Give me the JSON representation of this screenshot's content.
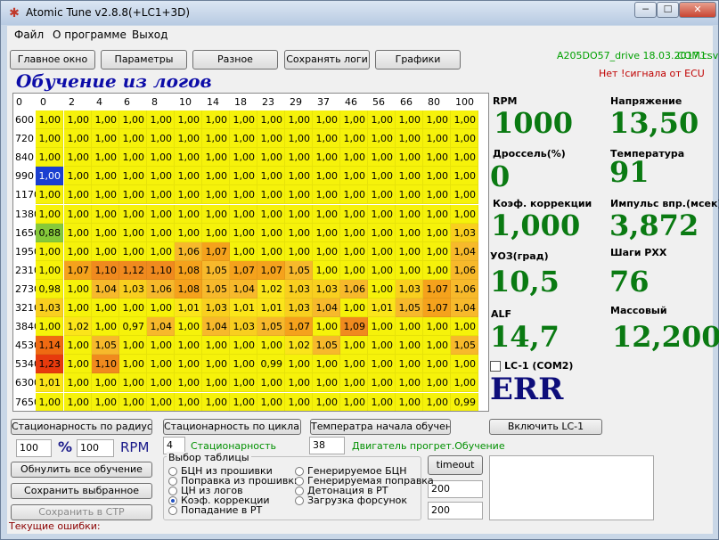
{
  "window": {
    "title": "Atomic Tune  v2.8.8(+LC1+3D)",
    "app_icon": "star-icon",
    "min": "─",
    "max": "☐",
    "close": "✕"
  },
  "menu": [
    "Файл",
    "О программе",
    "Выход"
  ],
  "toolbar": [
    "Главное окно",
    "Параметры",
    "Разное",
    "Сохранять логи",
    "Графики"
  ],
  "heading": "Обучение из логов",
  "ecu": {
    "file": "A205DO57_drive 18.03.2017.csv",
    "com": "COM1:",
    "status": "Нет !сигнала от ECU"
  },
  "table": {
    "throttle": [
      "0",
      "0",
      "2",
      "4",
      "6",
      "8",
      "10",
      "14",
      "18",
      "23",
      "29",
      "37",
      "46",
      "56",
      "66",
      "80",
      "100"
    ],
    "rpm": [
      "600",
      "720",
      "840",
      "990",
      "1170",
      "1380",
      "1650",
      "1950",
      "2310",
      "2730",
      "3210",
      "3840",
      "4530",
      "5340",
      "6300",
      "7650"
    ],
    "rows": [
      [
        "1,00",
        "1,00",
        "1,00",
        "1,00",
        "1,00",
        "1,00",
        "1,00",
        "1,00",
        "1,00",
        "1,00",
        "1,00",
        "1,00",
        "1,00",
        "1,00",
        "1,00",
        "1,00"
      ],
      [
        "1,00",
        "1,00",
        "1,00",
        "1,00",
        "1,00",
        "1,00",
        "1,00",
        "1,00",
        "1,00",
        "1,00",
        "1,00",
        "1,00",
        "1,00",
        "1,00",
        "1,00",
        "1,00"
      ],
      [
        "1,00",
        "1,00",
        "1,00",
        "1,00",
        "1,00",
        "1,00",
        "1,00",
        "1,00",
        "1,00",
        "1,00",
        "1,00",
        "1,00",
        "1,00",
        "1,00",
        "1,00",
        "1,00"
      ],
      [
        "1,00",
        "1,00",
        "1,00",
        "1,00",
        "1,00",
        "1,00",
        "1,00",
        "1,00",
        "1,00",
        "1,00",
        "1,00",
        "1,00",
        "1,00",
        "1,00",
        "1,00",
        "1,00"
      ],
      [
        "1,00",
        "1,00",
        "1,00",
        "1,00",
        "1,00",
        "1,00",
        "1,00",
        "1,00",
        "1,00",
        "1,00",
        "1,00",
        "1,00",
        "1,00",
        "1,00",
        "1,00",
        "1,00"
      ],
      [
        "1,00",
        "1,00",
        "1,00",
        "1,00",
        "1,00",
        "1,00",
        "1,00",
        "1,00",
        "1,00",
        "1,00",
        "1,00",
        "1,00",
        "1,00",
        "1,00",
        "1,00",
        "1,00"
      ],
      [
        "0,88",
        "1,00",
        "1,00",
        "1,00",
        "1,00",
        "1,00",
        "1,00",
        "1,00",
        "1,00",
        "1,00",
        "1,00",
        "1,00",
        "1,00",
        "1,00",
        "1,00",
        "1,03"
      ],
      [
        "1,00",
        "1,00",
        "1,00",
        "1,00",
        "1,00",
        "1,06",
        "1,07",
        "1,00",
        "1,00",
        "1,00",
        "1,00",
        "1,00",
        "1,00",
        "1,00",
        "1,00",
        "1,04"
      ],
      [
        "1,00",
        "1,07",
        "1,10",
        "1,12",
        "1,10",
        "1,08",
        "1,05",
        "1,07",
        "1,07",
        "1,05",
        "1,00",
        "1,00",
        "1,00",
        "1,00",
        "1,00",
        "1,06"
      ],
      [
        "0,98",
        "1,00",
        "1,04",
        "1,03",
        "1,06",
        "1,08",
        "1,05",
        "1,04",
        "1,02",
        "1,03",
        "1,03",
        "1,06",
        "1,00",
        "1,03",
        "1,07",
        "1,06"
      ],
      [
        "1,03",
        "1,00",
        "1,00",
        "1,00",
        "1,00",
        "1,01",
        "1,03",
        "1,01",
        "1,01",
        "1,03",
        "1,04",
        "1,00",
        "1,01",
        "1,05",
        "1,07",
        "1,04"
      ],
      [
        "1,00",
        "1,02",
        "1,00",
        "0,97",
        "1,04",
        "1,00",
        "1,04",
        "1,03",
        "1,05",
        "1,07",
        "1,00",
        "1,09",
        "1,00",
        "1,00",
        "1,00",
        "1,00"
      ],
      [
        "1,14",
        "1,00",
        "1,05",
        "1,00",
        "1,00",
        "1,00",
        "1,00",
        "1,00",
        "1,00",
        "1,02",
        "1,05",
        "1,00",
        "1,00",
        "1,00",
        "1,00",
        "1,05"
      ],
      [
        "1,23",
        "1,00",
        "1,10",
        "1,00",
        "1,00",
        "1,00",
        "1,00",
        "1,00",
        "0,99",
        "1,00",
        "1,00",
        "1,00",
        "1,00",
        "1,00",
        "1,00",
        "1,00"
      ],
      [
        "1,01",
        "1,00",
        "1,00",
        "1,00",
        "1,00",
        "1,00",
        "1,00",
        "1,00",
        "1,00",
        "1,00",
        "1,00",
        "1,00",
        "1,00",
        "1,00",
        "1,00",
        "1,00"
      ],
      [
        "1,00",
        "1,00",
        "1,00",
        "1,00",
        "1,00",
        "1,00",
        "1,00",
        "1,00",
        "1,00",
        "1,00",
        "1,00",
        "1,00",
        "1,00",
        "1,00",
        "1,00",
        "0,99"
      ]
    ],
    "highlight": {
      "selected_cell_color": "#1a3fd0",
      "lean_cell_color": "#86c93a"
    }
  },
  "sensors": [
    {
      "label": "RPM",
      "value": "1000"
    },
    {
      "label": "Напряжение",
      "value": "13,50"
    },
    {
      "label": "Дроссель(%)",
      "value": "0"
    },
    {
      "label": "Температура",
      "value": "91"
    },
    {
      "label": "Коэф. коррекции",
      "value": "1,000"
    },
    {
      "label": "Импульс впр.(мсек)",
      "value": "3,872"
    },
    {
      "label": "УОЗ(град)",
      "value": "10,5"
    },
    {
      "label": "Шаги РХХ",
      "value": "76"
    },
    {
      "label": "ALF",
      "value": "14,7"
    },
    {
      "label": "Массовый",
      "value": "12,200"
    }
  ],
  "lc1": {
    "label": "LC-1 (COM2)",
    "value": "ERR"
  },
  "buttons": {
    "stat_radius": "Стационарность по радиусам",
    "stat_cycles": "Стационарность по циклам",
    "temp_start": "Температра начала обучения",
    "enable_lc1": "Включить LC-1",
    "reset": "Обнулить все обучение",
    "save_sel": "Сохранить выбранное",
    "save_ctp": "Сохранить в СТР",
    "timeout": "timeout"
  },
  "inputs": {
    "pct": "100",
    "pct_unit": "%",
    "rpm": "100",
    "rpm_unit": "RPM",
    "stat_value": "4",
    "stat_label": "Стационарность",
    "temp_value": "38",
    "temp_label": "Двигатель прогрет.Обучение",
    "timeout1": "200",
    "timeout2": "200"
  },
  "table_select": {
    "title": "Выбор таблицы",
    "left": [
      "БЦН из прошивки",
      "Поправка из прошивки",
      "ЦН из логов",
      "Коэф. коррекции",
      "Попадание в РТ"
    ],
    "right": [
      "Генерируемое БЦН",
      "Генерируемая поправка",
      "Детонация в РТ",
      "Загрузка форсунок"
    ],
    "selected": "Коэф. коррекции"
  },
  "status": {
    "errors_label": "Текущие ошибки:"
  }
}
